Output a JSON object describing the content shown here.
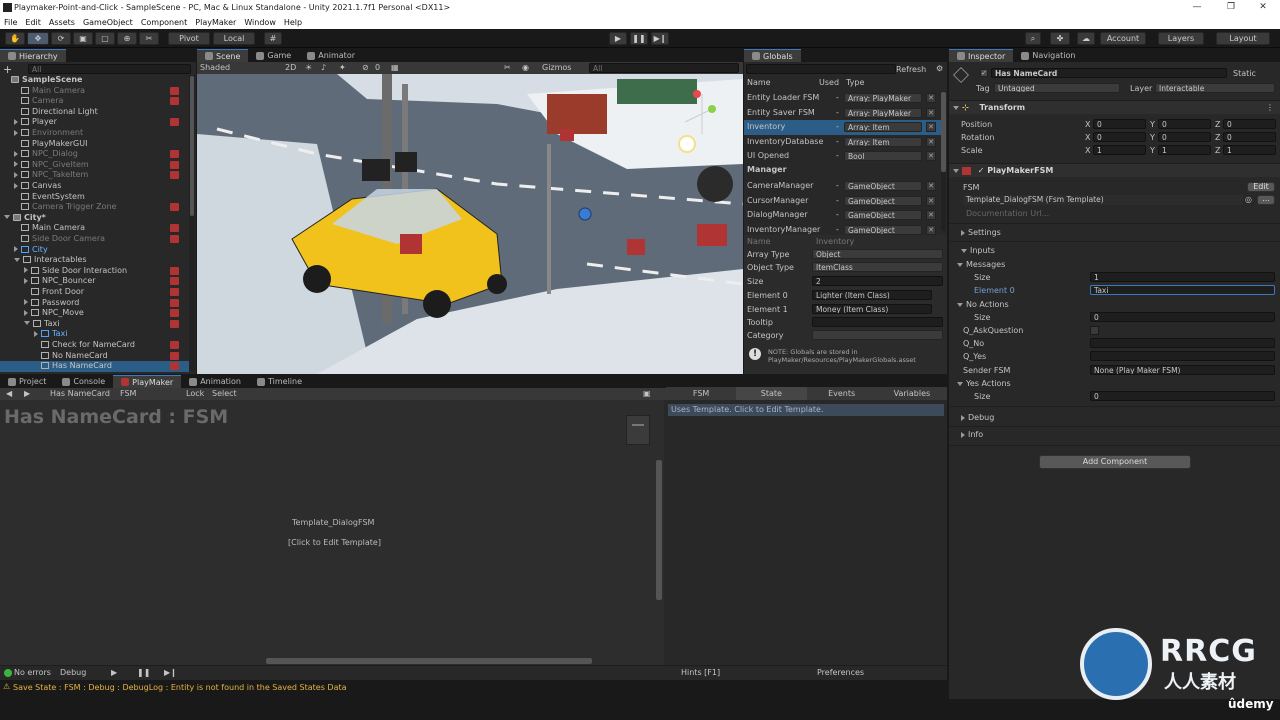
{
  "window": {
    "title": "Playmaker-Point-and-Click - SampleScene - PC, Mac & Linux Standalone - Unity 2021.1.7f1 Personal <DX11>",
    "minimize": "—",
    "maximize": "❐",
    "close": "✕"
  },
  "menu": [
    "File",
    "Edit",
    "Assets",
    "GameObject",
    "Component",
    "PlayMaker",
    "Window",
    "Help"
  ],
  "toolbar": {
    "pivot": "Pivot",
    "local": "Local",
    "account": "Account",
    "layers": "Layers",
    "layout": "Layout"
  },
  "hierarchy": {
    "tab": "Hierarchy",
    "search_placeholder": "All",
    "items": [
      {
        "label": "SampleScene",
        "indent": 0,
        "scene": true
      },
      {
        "label": "Main Camera",
        "indent": 1,
        "dim": true,
        "pm": true
      },
      {
        "label": "Camera",
        "indent": 1,
        "dim": true,
        "pm": true
      },
      {
        "label": "Directional Light",
        "indent": 1
      },
      {
        "label": "Player",
        "indent": 1,
        "arrow": "r",
        "pm": true
      },
      {
        "label": "Environment",
        "indent": 1,
        "arrow": "r",
        "dim": true
      },
      {
        "label": "PlayMakerGUI",
        "indent": 1
      },
      {
        "label": "NPC_Dialog",
        "indent": 1,
        "arrow": "r",
        "dim": true,
        "pm": true
      },
      {
        "label": "NPC_GiveItem",
        "indent": 1,
        "arrow": "r",
        "dim": true,
        "pm": true
      },
      {
        "label": "NPC_TakeItem",
        "indent": 1,
        "arrow": "r",
        "dim": true,
        "pm": true
      },
      {
        "label": "Canvas",
        "indent": 1,
        "arrow": "r"
      },
      {
        "label": "EventSystem",
        "indent": 1
      },
      {
        "label": "Camera Trigger Zone",
        "indent": 1,
        "dim": true,
        "pm": true
      },
      {
        "label": "City*",
        "indent": 0,
        "arrow": "d",
        "scene": true
      },
      {
        "label": "Main Camera",
        "indent": 1,
        "pm": true
      },
      {
        "label": "Side Door Camera",
        "indent": 1,
        "dim": true,
        "pm": true
      },
      {
        "label": "City",
        "indent": 1,
        "arrow": "r",
        "blue": true
      },
      {
        "label": "Interactables",
        "indent": 1,
        "arrow": "d"
      },
      {
        "label": "Side Door Interaction",
        "indent": 2,
        "arrow": "r",
        "pm": true
      },
      {
        "label": "NPC_Bouncer",
        "indent": 2,
        "arrow": "r",
        "pm": true
      },
      {
        "label": "Front Door",
        "indent": 2,
        "pm": true
      },
      {
        "label": "Password",
        "indent": 2,
        "arrow": "r",
        "pm": true
      },
      {
        "label": "NPC_Move",
        "indent": 2,
        "arrow": "r",
        "pm": true
      },
      {
        "label": "Taxi",
        "indent": 2,
        "arrow": "d",
        "pm": true
      },
      {
        "label": "Taxi",
        "indent": 3,
        "arrow": "r",
        "blue": true
      },
      {
        "label": "Check for NameCard",
        "indent": 3,
        "pm": true
      },
      {
        "label": "No NameCard",
        "indent": 3,
        "pm": true
      },
      {
        "label": "Has NameCard",
        "indent": 3,
        "pm": true,
        "sel": true
      }
    ]
  },
  "scene": {
    "tabs": [
      "Scene",
      "Game",
      "Animator"
    ],
    "shading": "Shaded",
    "mode2d": "2D",
    "hidden_count": "0",
    "gizmos": "Gizmos",
    "search_placeholder": "All",
    "persp": "< Persp"
  },
  "globals": {
    "tab": "Globals",
    "refresh": "Refresh",
    "headers": {
      "name": "Name",
      "used": "Used",
      "type": "Type"
    },
    "vars": [
      {
        "name": "Entity Loader FSM",
        "used": "-",
        "type": "Array: PlayMaker"
      },
      {
        "name": "Entity Saver FSM",
        "used": "-",
        "type": "Array: PlayMaker"
      },
      {
        "name": "Inventory",
        "used": "-",
        "type": "Array: Item",
        "sel": true
      },
      {
        "name": "InventoryDatabase",
        "used": "-",
        "type": "Array: Item"
      },
      {
        "name": "UI Opened",
        "used": "-",
        "type": "Bool"
      }
    ],
    "manager_title": "Manager",
    "manager_vars": [
      {
        "name": "CameraManager",
        "used": "-",
        "type": "GameObject"
      },
      {
        "name": "CursorManager",
        "used": "-",
        "type": "GameObject"
      },
      {
        "name": "DialogManager",
        "used": "-",
        "type": "GameObject"
      },
      {
        "name": "InventoryManager",
        "used": "-",
        "type": "GameObject"
      }
    ],
    "detail": {
      "name_label": "Name",
      "name_value": "Inventory",
      "array_type_label": "Array Type",
      "array_type": "Object",
      "object_type_label": "Object Type",
      "object_type": "ItemClass",
      "size_label": "Size",
      "size": "2",
      "el0_label": "Element 0",
      "el0": "Lighter (Item Class)",
      "el1_label": "Element 1",
      "el1": "Money (Item Class)",
      "tooltip_label": "Tooltip",
      "category_label": "Category"
    },
    "note": "NOTE: Globals are stored in PlayMaker/Resources/PlayMakerGlobals.asset"
  },
  "inspector": {
    "tabs": [
      "Inspector",
      "Navigation"
    ],
    "object_name": "Has NameCard",
    "static": "Static",
    "tag_label": "Tag",
    "tag": "Untagged",
    "layer_label": "Layer",
    "layer": "Interactable",
    "transform_title": "Transform",
    "position_label": "Position",
    "position": [
      "0",
      "0",
      "0"
    ],
    "rotation_label": "Rotation",
    "rotation": [
      "0",
      "0",
      "0"
    ],
    "scale_label": "Scale",
    "scale": [
      "1",
      "1",
      "1"
    ],
    "pm_title": "PlayMakerFSM",
    "fsm_label": "FSM",
    "edit": "Edit",
    "template": "Template_DialogFSM (Fsm Template)",
    "doc_url": "Documentation Url...",
    "settings": "Settings",
    "inputs": "Inputs",
    "messages": "Messages",
    "messages_size_label": "Size",
    "messages_size": "1",
    "element0_label": "Element 0",
    "element0": "Taxi",
    "no_actions": "No Actions",
    "no_actions_size_label": "Size",
    "no_actions_size": "0",
    "q_ask": "Q_AskQuestion",
    "q_no": "Q_No",
    "q_yes": "Q_Yes",
    "sender_label": "Sender FSM",
    "sender": "None (Play Maker FSM)",
    "yes_actions": "Yes Actions",
    "yes_size_label": "Size",
    "yes_size": "0",
    "debug": "Debug",
    "info": "Info",
    "add_component": "Add Component"
  },
  "bottom": {
    "tabs": [
      "Project",
      "Console",
      "PlayMaker",
      "Animation",
      "Timeline"
    ],
    "selector": "Has NameCard",
    "fsm_select": "FSM",
    "lock": "Lock",
    "select": "Select",
    "graph_title": "Has NameCard : FSM",
    "node_title": "Template_DialogFSM",
    "node_hint": "[Click to Edit Template]",
    "right_tabs": [
      "FSM",
      "State",
      "Events",
      "Variables"
    ],
    "template_msg": "Uses Template. Click to Edit Template.",
    "errors": "No errors",
    "debug": "Debug",
    "hints": "Hints [F1]",
    "preferences": "Preferences"
  },
  "status": {
    "message": "Save State : FSM : Debug : DebugLog : Entity is not found in the Saved States Data"
  },
  "watermark": {
    "brand": "RRCG",
    "sub": "人人素材",
    "udemy": "ûdemy"
  }
}
